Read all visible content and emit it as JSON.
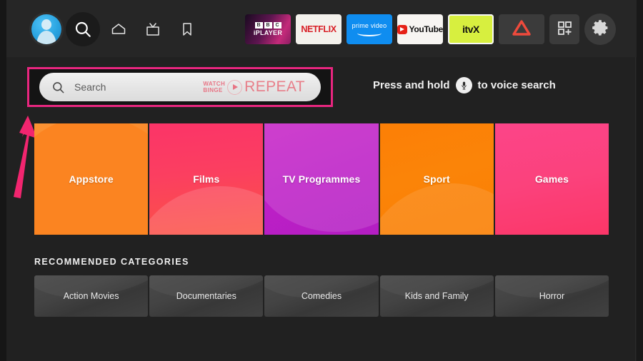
{
  "theme": {
    "bg": "#212121",
    "nav_bg": "#262626",
    "highlight_pink": "#e8267f",
    "arrow_pink": "#f2256f",
    "text": "#efefef"
  },
  "topnav": {
    "profile": {
      "name": "profile-avatar",
      "icon": "user-avatar-icon"
    },
    "items": [
      {
        "id": "search",
        "icon": "search-icon",
        "label": "Search"
      },
      {
        "id": "home",
        "icon": "home-icon",
        "label": "Home"
      },
      {
        "id": "live-tv",
        "icon": "tv-icon",
        "label": "Live TV"
      },
      {
        "id": "watchlist",
        "icon": "bookmark-icon",
        "label": "Watchlist"
      }
    ],
    "apps": [
      {
        "id": "bbc-iplayer",
        "blocks": [
          "B",
          "B",
          "C"
        ],
        "word": "iPLAYER",
        "label": "BBC iPlayer"
      },
      {
        "id": "netflix",
        "label": "NETFLIX"
      },
      {
        "id": "prime-video",
        "label": "prime video"
      },
      {
        "id": "youtube",
        "label": "YouTube"
      },
      {
        "id": "itvx",
        "label": "itvX"
      },
      {
        "id": "triangle-app",
        "label": "",
        "icon": "triangle-icon"
      },
      {
        "id": "apps-grid",
        "label": "",
        "icon": "apps-grid-add-icon"
      },
      {
        "id": "settings",
        "label": "",
        "icon": "gear-icon"
      }
    ]
  },
  "search": {
    "placeholder": "Search",
    "value": "",
    "icon": "search-icon",
    "watermark": {
      "line1": "WATCH",
      "line2": "BINGE",
      "play_icon": "play-circle-icon",
      "word": "REPEAT"
    }
  },
  "voice": {
    "text_before": "Press and hold",
    "icon": "microphone-icon",
    "text_after": "to voice search"
  },
  "annotation": {
    "arrow": "arrow-pointing-to-search-bar",
    "highlight_target": "search-bar"
  },
  "tiles": [
    {
      "id": "appstore",
      "label": "Appstore",
      "color": "#fb8a2b"
    },
    {
      "id": "films",
      "label": "Films",
      "color": "#fb3f60"
    },
    {
      "id": "tv-programmes",
      "label": "TV Programmes",
      "color": "#bd1fc6"
    },
    {
      "id": "sport",
      "label": "Sport",
      "color": "#fb8408"
    },
    {
      "id": "games",
      "label": "Games",
      "color": "#fb2d6e"
    }
  ],
  "recommended": {
    "title": "RECOMMENDED CATEGORIES",
    "items": [
      {
        "id": "action-movies",
        "label": "Action Movies"
      },
      {
        "id": "documentaries",
        "label": "Documentaries"
      },
      {
        "id": "comedies",
        "label": "Comedies"
      },
      {
        "id": "kids-and-family",
        "label": "Kids and Family"
      },
      {
        "id": "horror",
        "label": "Horror"
      }
    ]
  }
}
